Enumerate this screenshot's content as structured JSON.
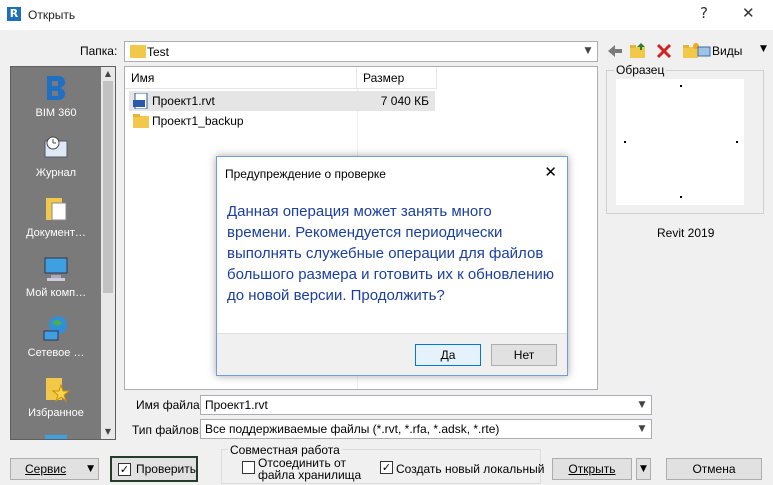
{
  "window": {
    "title": "Открыть",
    "help": "?",
    "close": "✕"
  },
  "folder": {
    "label": "Папка:",
    "value": "Test"
  },
  "toolbar": {
    "views_label": "Виды"
  },
  "places": [
    {
      "label": "BIM 360"
    },
    {
      "label": "Журнал"
    },
    {
      "label": "Документ…"
    },
    {
      "label": "Мой комп…"
    },
    {
      "label": "Сетевое …"
    },
    {
      "label": "Избранное"
    }
  ],
  "filelist": {
    "columns": {
      "name": "Имя",
      "size": "Размер"
    },
    "rows": [
      {
        "name": "Проект1.rvt",
        "size": "7 040 КБ",
        "icon": "rvt-file-icon"
      },
      {
        "name": "Проект1_backup",
        "size": "",
        "icon": "folder-icon"
      }
    ]
  },
  "preview": {
    "label": "Образец",
    "version": "Revit 2019"
  },
  "filename": {
    "label": "Имя файла:",
    "value": "Проект1.rvt"
  },
  "filetype": {
    "label": "Тип файлов:",
    "value": "Все поддерживаемые файлы  (*.rvt, *.rfa, *.adsk, *.rte)"
  },
  "buttons": {
    "service": "Сервис",
    "audit": "Проверить",
    "open": "Открыть",
    "cancel": "Отмена"
  },
  "worksharing": {
    "label": "Совместная работа",
    "detach_line1": "Отсоединить от",
    "detach_line2": "файла хранилища",
    "create_local": "Создать новый локальный"
  },
  "dialog": {
    "title": "Предупреждение о проверке",
    "message": "Данная операция может занять много времени. Рекомендуется периодически выполнять служебные операции для файлов большого размера и готовить их к обновлению до новой версии. Продолжить?",
    "yes": "Да",
    "no": "Нет"
  },
  "colors": {
    "accent": "#1a3fa0",
    "dialog_border": "#6f9fd6",
    "revit_blue": "#1e6fb8"
  }
}
